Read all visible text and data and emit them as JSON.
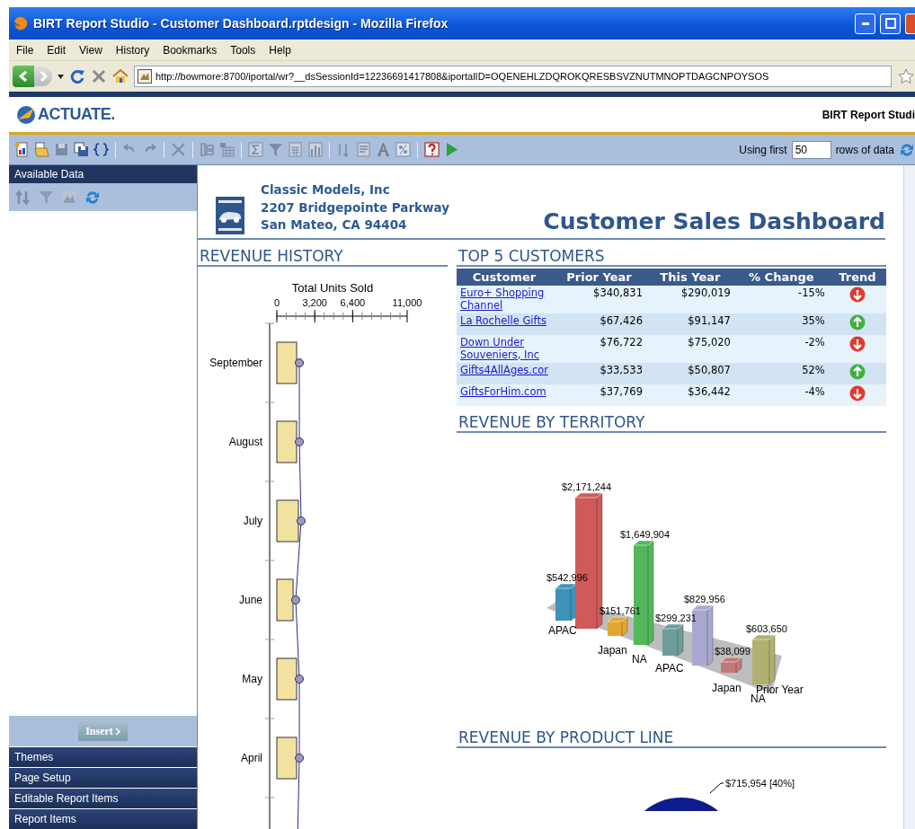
{
  "window": {
    "title": "BIRT Report Studio - Customer Dashboard.rptdesign - Mozilla Firefox"
  },
  "menu": [
    "File",
    "Edit",
    "View",
    "History",
    "Bookmarks",
    "Tools",
    "Help"
  ],
  "address_bar": {
    "value": "http://bowmore:8700/iportal/wr?__dsSessionId=12236691417808&iportalID=OQENEHLZDQROKQRESBSVZNUTMNOPTDAGCNPOYSOS"
  },
  "app_header": {
    "logo": "ACTUATE.",
    "product": "BIRT Report Studi"
  },
  "toolbar": {
    "rows_prefix": "Using first",
    "rows_value": "50",
    "rows_suffix": "rows of data"
  },
  "sidebar": {
    "header": "Available Data",
    "insert_button": "Insert",
    "sections": [
      "Themes",
      "Page Setup",
      "Editable Report Items",
      "Report Items"
    ]
  },
  "report": {
    "company": [
      "Classic Models, Inc",
      "2207 Bridgepointe Parkway",
      "San Mateo, CA 94404"
    ],
    "title": "Customer Sales Dashboard",
    "revenue_history": {
      "heading": "REVENUE HISTORY",
      "chart_data": {
        "type": "bar",
        "orientation": "horizontal",
        "title": "Total Units Sold",
        "categories": [
          "September",
          "August",
          "July",
          "June",
          "May",
          "April"
        ],
        "xticks": [
          0,
          {
            "value": 3200,
            "label": "3,200"
          },
          {
            "value": 6400,
            "label": "6,400"
          },
          {
            "value": 11000,
            "label": "11,000"
          }
        ],
        "xlim": [
          0,
          11000
        ],
        "series": [
          {
            "type": "bar",
            "color": "#f2e2a0",
            "values": [
              1670,
              1670,
              1820,
              1370,
              1670,
              1670
            ]
          },
          {
            "type": "line",
            "color": "#2a2a8a",
            "marker": true,
            "values": [
              1900,
              1900,
              2050,
              1590,
              1900,
              1900
            ]
          }
        ]
      }
    },
    "top_customers": {
      "heading": "TOP 5 CUSTOMERS",
      "columns": [
        "Customer",
        "Prior Year",
        "This Year",
        "% Change",
        "Trend"
      ],
      "rows": [
        {
          "customer": "Euro+ Shopping Channel",
          "prior_year": "$340,831",
          "this_year": "$290,019",
          "change": "-15%",
          "trend_up": false
        },
        {
          "customer": "La Rochelle Gifts",
          "prior_year": "$67,426",
          "this_year": "$91,147",
          "change": "35%",
          "trend_up": true
        },
        {
          "customer": "Down Under Souveniers, Inc",
          "prior_year": "$76,722",
          "this_year": "$75,020",
          "change": "-2%",
          "trend_up": false
        },
        {
          "customer": "Gifts4AllAges.cor",
          "prior_year": "$33,533",
          "this_year": "$50,807",
          "change": "52%",
          "trend_up": true
        },
        {
          "customer": "GiftsForHim.com",
          "prior_year": "$37,769",
          "this_year": "$36,442",
          "change": "-4%",
          "trend_up": false
        }
      ]
    },
    "revenue_by_territory": {
      "heading": "REVENUE BY TERRITORY",
      "axis_labels": [
        "APAC",
        "Japan",
        "NA",
        "APAC",
        "Japan",
        "Prior Year",
        "NA"
      ],
      "bars": [
        {
          "label": "$542,996",
          "color": "#3f93b8"
        },
        {
          "label": "$2,171,244",
          "color": "#d05a5a"
        },
        {
          "label": "$151,761",
          "color": "#e0a830"
        },
        {
          "label": "$1,649,904",
          "color": "#52b85a"
        },
        {
          "label": "$299,231",
          "color": "#6e9c9c"
        },
        {
          "label": "$829,956",
          "color": "#a8a8d0"
        },
        {
          "label": "$38,099",
          "color": "#c07878"
        },
        {
          "label": "$603,650",
          "color": "#b0b070"
        }
      ]
    },
    "revenue_by_product_line": {
      "heading": "REVENUE BY PRODUCT LINE",
      "slice_label": "$715,954 [40%]"
    }
  }
}
